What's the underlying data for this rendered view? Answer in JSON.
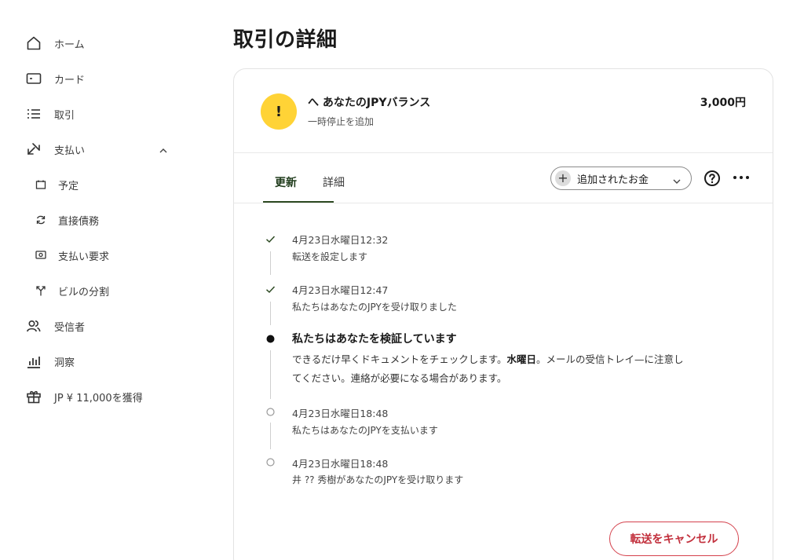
{
  "sidebar": {
    "items": [
      {
        "label": "ホーム",
        "icon": "home-icon"
      },
      {
        "label": "カード",
        "icon": "card-icon"
      },
      {
        "label": "取引",
        "icon": "list-icon"
      },
      {
        "label": "支払い",
        "icon": "transfer-icon"
      },
      {
        "label": "予定",
        "icon": "calendar-icon"
      },
      {
        "label": "直接債務",
        "icon": "refresh-icon"
      },
      {
        "label": "支払い要求",
        "icon": "request-icon"
      },
      {
        "label": "ビルの分割",
        "icon": "split-icon"
      },
      {
        "label": "受信者",
        "icon": "recipients-icon"
      },
      {
        "label": "洞察",
        "icon": "chart-icon"
      },
      {
        "label": "JP ¥ 11,000を獲得",
        "icon": "gift-icon"
      }
    ]
  },
  "page": {
    "title": "取引の詳細"
  },
  "summary": {
    "title": "へ あなたのJPYバランス",
    "subtitle": "一時停止を追加",
    "amount": "3,000円",
    "alert_glyph": "!"
  },
  "tabs": [
    {
      "label": "更新",
      "active": true
    },
    {
      "label": "詳細",
      "active": false
    }
  ],
  "filter": {
    "label": "追加されたお金"
  },
  "timeline": [
    {
      "status": "done",
      "date": "4月23日水曜日12:32",
      "desc": "転送を設定します"
    },
    {
      "status": "done",
      "date": "4月23日水曜日12:47",
      "desc": "私たちはあなたのJPYを受け取りました"
    },
    {
      "status": "current",
      "title": "私たちはあなたを検証しています",
      "body_pre": "できるだけ早くドキュメントをチェックします。",
      "body_bold": "水曜日",
      "body_post": "。メールの受信トレイ—に注意してください。連絡が必要になる場合があります。"
    },
    {
      "status": "pending",
      "date": "4月23日水曜日18:48",
      "desc": "私たちはあなたのJPYを支払います"
    },
    {
      "status": "pending",
      "date": "4月23日水曜日18:48",
      "desc": "井 ?? 秀樹があなたのJPYを受け取ります"
    }
  ],
  "actions": {
    "cancel_label": "転送をキャンセル"
  },
  "colors": {
    "accent": "#2d4a22",
    "alert": "#ffd336",
    "danger": "#c22f3c"
  }
}
